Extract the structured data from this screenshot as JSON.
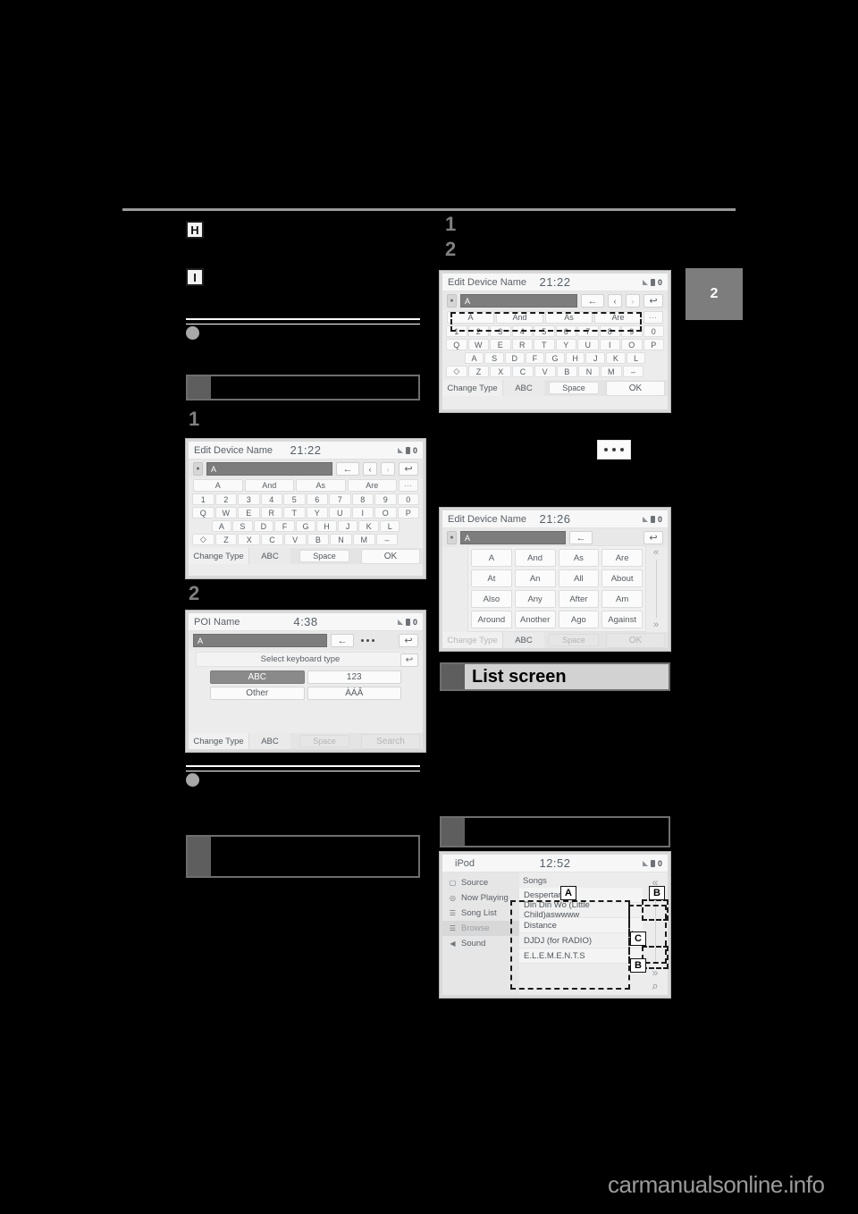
{
  "page": {
    "watermark": "carmanualsonline.info",
    "chapter_tab": "2"
  },
  "callout_letters": {
    "h": "H",
    "i": "I"
  },
  "steps": {
    "one": "1",
    "two": "2"
  },
  "section_headers": {
    "list_screen": "List screen"
  },
  "screens": {
    "edit_device_name_1": {
      "title": "Edit Device Name",
      "clock": "21:22",
      "field_value": "A",
      "backspace": "←",
      "nav_prev": "‹",
      "nav_next": "›",
      "return": "↩",
      "predictions": [
        "A",
        "And",
        "As",
        "Are"
      ],
      "more": "⋯",
      "rows": [
        [
          "1",
          "2",
          "3",
          "4",
          "5",
          "6",
          "7",
          "8",
          "9",
          "0"
        ],
        [
          "Q",
          "W",
          "E",
          "R",
          "T",
          "Y",
          "U",
          "I",
          "O",
          "P"
        ],
        [
          "A",
          "S",
          "D",
          "F",
          "G",
          "H",
          "J",
          "K",
          "L"
        ],
        [
          "◇",
          "Z",
          "X",
          "C",
          "V",
          "B",
          "N",
          "M",
          "–"
        ]
      ],
      "change_type": "Change Type",
      "abc": "ABC",
      "space": "Space",
      "action": "OK"
    },
    "poi_name": {
      "title": "POI Name",
      "clock": "4:38",
      "field_value": "A",
      "backspace": "←",
      "return": "↩",
      "panel_title": "Select keyboard type",
      "types": [
        "ABC",
        "123",
        "Other",
        "ÀÁÂ"
      ],
      "selected_type": "ABC",
      "change_type": "Change Type",
      "abc": "ABC",
      "space": "Space",
      "action": "Search"
    },
    "edit_device_name_2": {
      "title": "Edit Device Name",
      "clock": "21:22",
      "field_value": "A",
      "backspace": "←",
      "nav_prev": "‹",
      "nav_next": "›",
      "return": "↩",
      "predictions": [
        "A",
        "And",
        "As",
        "Are"
      ],
      "more": "⋯",
      "rows": [
        [
          "1",
          "2",
          "3",
          "4",
          "5",
          "6",
          "7",
          "8",
          "9",
          "0"
        ],
        [
          "Q",
          "W",
          "E",
          "R",
          "T",
          "Y",
          "U",
          "I",
          "O",
          "P"
        ],
        [
          "A",
          "S",
          "D",
          "F",
          "G",
          "H",
          "J",
          "K",
          "L"
        ],
        [
          "◇",
          "Z",
          "X",
          "C",
          "V",
          "B",
          "N",
          "M",
          "–"
        ]
      ],
      "change_type": "Change Type",
      "abc": "ABC",
      "space": "Space",
      "action": "OK"
    },
    "edit_device_name_3": {
      "title": "Edit Device Name",
      "clock": "21:26",
      "field_value": "A",
      "backspace": "←",
      "return": "↩",
      "predictions": [
        "A",
        "And",
        "As",
        "Are",
        "At",
        "An",
        "All",
        "About",
        "Also",
        "Any",
        "After",
        "Am",
        "Around",
        "Another",
        "Ago",
        "Against"
      ],
      "scroll_up": "«",
      "scroll_down": "»",
      "change_type": "Change Type",
      "abc": "ABC",
      "space": "Space",
      "action": "OK"
    },
    "ipod": {
      "title": "iPod",
      "clock": "12:52",
      "sidebar": [
        {
          "label": "Source",
          "icon": "source-icon",
          "selected": false
        },
        {
          "label": "Now Playing",
          "icon": "play-circle-icon",
          "selected": false
        },
        {
          "label": "Song List",
          "icon": "list-icon",
          "selected": false
        },
        {
          "label": "Browse",
          "icon": "browse-icon",
          "selected": true
        },
        {
          "label": "Sound",
          "icon": "speaker-icon",
          "selected": false
        }
      ],
      "list_header": "Songs",
      "rows": [
        "Despertar",
        "Din Din Wo (Little Child)aswwww",
        "Distance",
        "DJDJ (for RADIO)",
        "E.L.E.M.E.N.T.S"
      ],
      "scroll_up": "«",
      "scroll_down": "»",
      "search_icon": "⌕",
      "callouts": {
        "a": "A",
        "b": "B",
        "c": "C"
      }
    }
  }
}
